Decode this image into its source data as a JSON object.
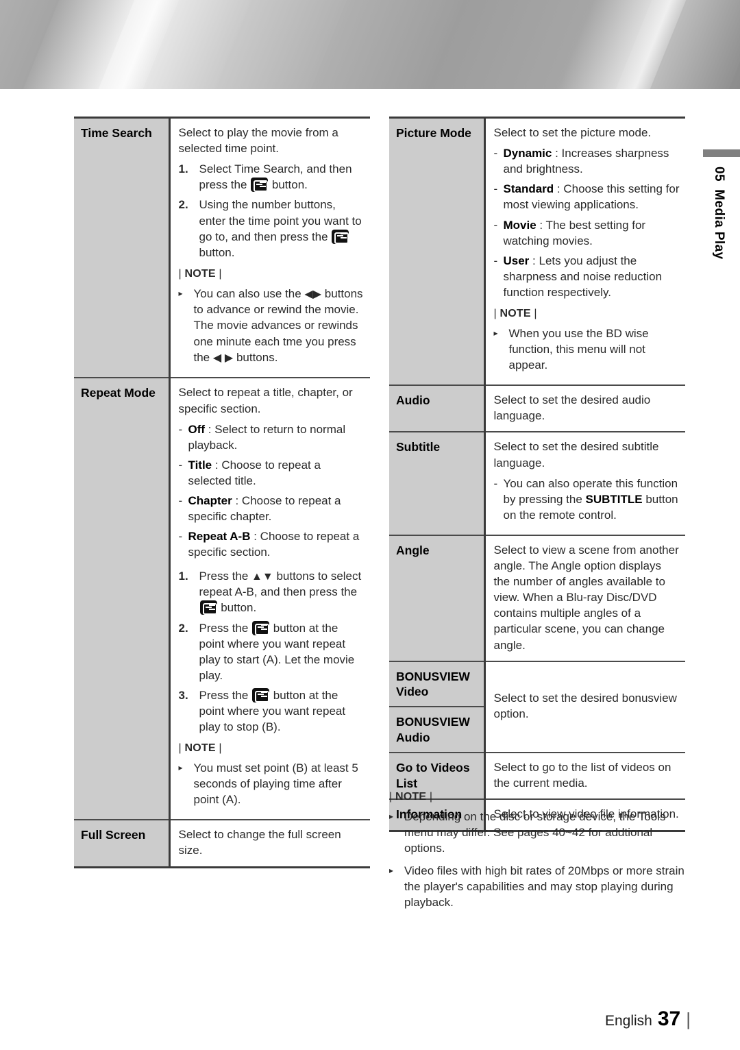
{
  "header": {
    "banner_style": "metallic-gradient"
  },
  "side_tab": {
    "number": "05",
    "label": "Media Play"
  },
  "footer": {
    "language": "English",
    "page_number": "37",
    "end_bar": "|"
  },
  "colors": {
    "label_cell_bg": "#cccccc",
    "rule": "#3a3a3a",
    "text": "#2a2a2a",
    "banner": "#9a9a9a"
  },
  "icons": {
    "enter_button": "enter-button-icon",
    "left_arrow": "◀",
    "right_arrow": "▶",
    "up_arrow": "▲",
    "down_arrow": "▼",
    "bullet": "▸",
    "dash": "-"
  },
  "note_label": {
    "open": "|",
    "text": "NOTE",
    "close": "|"
  },
  "left_table": {
    "rows": [
      {
        "label": "Time Search",
        "intro": "Select to play the movie from a selected time point.",
        "steps": [
          {
            "num": "1.",
            "parts": [
              "Select Time Search, and then press the ",
              "ENTER_ICON",
              " button."
            ]
          },
          {
            "num": "2.",
            "parts": [
              "Using the number buttons, enter the time point you want to go to, and then press the ",
              "ENTER_ICON",
              " button."
            ]
          }
        ],
        "note_bullets": [
          "You can also use the ◀▶ buttons to advance or rewind the movie. The movie advances or rewinds one minute each tme you press the ◀ ▶ buttons."
        ]
      },
      {
        "label": "Repeat Mode",
        "intro": "Select to repeat a title, chapter, or specific section.",
        "options": [
          {
            "term": "Off",
            "text": ": Select to return to normal playback."
          },
          {
            "term": "Title",
            "text": ": Choose to repeat a selected title."
          },
          {
            "term": "Chapter",
            "text": ": Choose to repeat a specific chapter."
          },
          {
            "term": "Repeat A-B",
            "text": ": Choose to repeat a specific section."
          }
        ],
        "steps": [
          {
            "num": "1.",
            "parts": [
              "Press the ▲▼ buttons to select repeat A-B, and then press the ",
              "ENTER_ICON",
              " button."
            ]
          },
          {
            "num": "2.",
            "parts": [
              "Press the ",
              "ENTER_ICON",
              " button at the point where you want repeat play to start (A). Let the movie play."
            ]
          },
          {
            "num": "3.",
            "parts": [
              "Press the ",
              "ENTER_ICON",
              " button at the point where you want repeat play to stop (B)."
            ]
          }
        ],
        "note_bullets": [
          "You must set point (B) at least 5 seconds of playing time after point (A)."
        ]
      },
      {
        "label": "Full Screen",
        "intro": "Select to change the full screen size."
      }
    ]
  },
  "right_table": {
    "rows": [
      {
        "label": "Picture Mode",
        "intro": "Select to set the picture mode.",
        "options": [
          {
            "term": "Dynamic",
            "text": ": Increases sharpness and brightness."
          },
          {
            "term": "Standard",
            "text": ": Choose this setting for most viewing applications."
          },
          {
            "term": "Movie",
            "text": ": The best setting for watching movies."
          },
          {
            "term": "User",
            "text": ": Lets you adjust the sharpness and noise reduction function respectively."
          }
        ],
        "note_bullets": [
          "When you use the BD wise function, this menu will not appear."
        ]
      },
      {
        "label": "Audio",
        "intro": "Select to set the desired audio language."
      },
      {
        "label": "Subtitle",
        "intro": "Select to set the desired subtitle language.",
        "dash_items": [
          "You can also operate this function by pressing the SUBTITLE button on the remote control."
        ],
        "dash_bold_word": "SUBTITLE"
      },
      {
        "label": "Angle",
        "intro": "Select to view a scene from another angle. The Angle option displays the number of angles available to view. When a Blu-ray Disc/DVD contains multiple angles of a particular scene, you can change angle."
      },
      {
        "label": "BONUSVIEW Video",
        "label_line1": "BONUSVIEW",
        "label_line2": "Video",
        "merged_desc": "Select to set the desired bonusview option."
      },
      {
        "label": "BONUSVIEW Audio",
        "label_line1": "BONUSVIEW",
        "label_line2": "Audio"
      },
      {
        "label": "Go to Videos List",
        "intro": "Select to go to the list of videos on the current media."
      },
      {
        "label": "Information",
        "intro": "Select to view video file information."
      }
    ]
  },
  "bottom_note": {
    "bullets": [
      "Depending on the disc or storage device, the Tools menu may differ. See pages 40~42 for addtional options.",
      "Video files with high bit rates of 20Mbps or more strain the player's capabilities and may stop playing during playback."
    ]
  }
}
